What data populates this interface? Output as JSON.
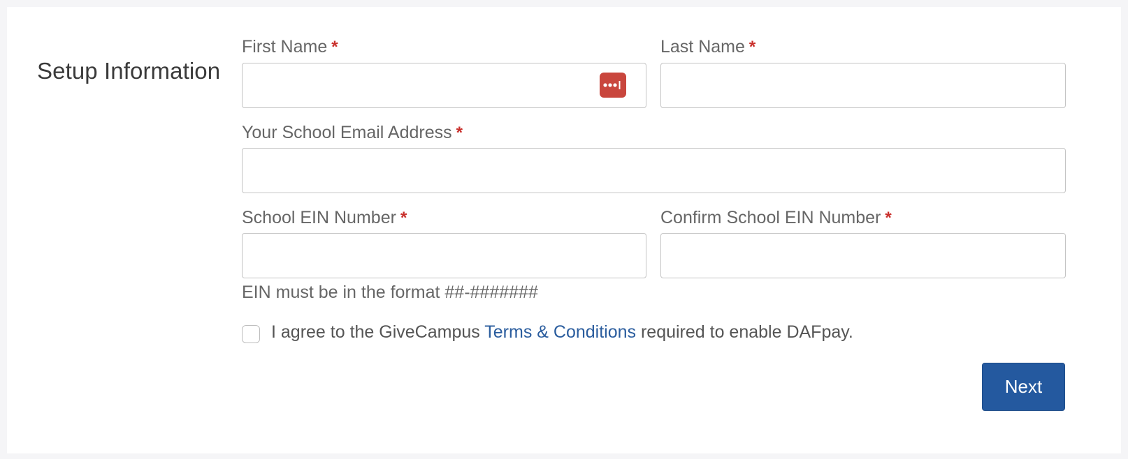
{
  "section": {
    "title": "Setup Information"
  },
  "fields": {
    "first_name": {
      "label": "First Name",
      "required_mark": "*",
      "value": ""
    },
    "last_name": {
      "label": "Last Name",
      "required_mark": "*",
      "value": ""
    },
    "email": {
      "label": "Your School Email Address",
      "required_mark": "*",
      "value": ""
    },
    "ein": {
      "label": "School EIN Number",
      "required_mark": "*",
      "value": ""
    },
    "confirm_ein": {
      "label": "Confirm School EIN Number",
      "required_mark": "*",
      "value": ""
    }
  },
  "hint": {
    "ein_format": "EIN must be in the format ##-#######"
  },
  "agreement": {
    "checked": false,
    "text_before": "I agree to the GiveCampus ",
    "link_text": "Terms & Conditions",
    "text_after": " required to enable DAFpay."
  },
  "actions": {
    "next_label": "Next"
  },
  "icons": {
    "password_manager": "password-manager-icon"
  },
  "colors": {
    "required": "#c9302c",
    "link": "#2b5d9e",
    "primary_button": "#24599f",
    "password_manager": "#c9463d"
  }
}
